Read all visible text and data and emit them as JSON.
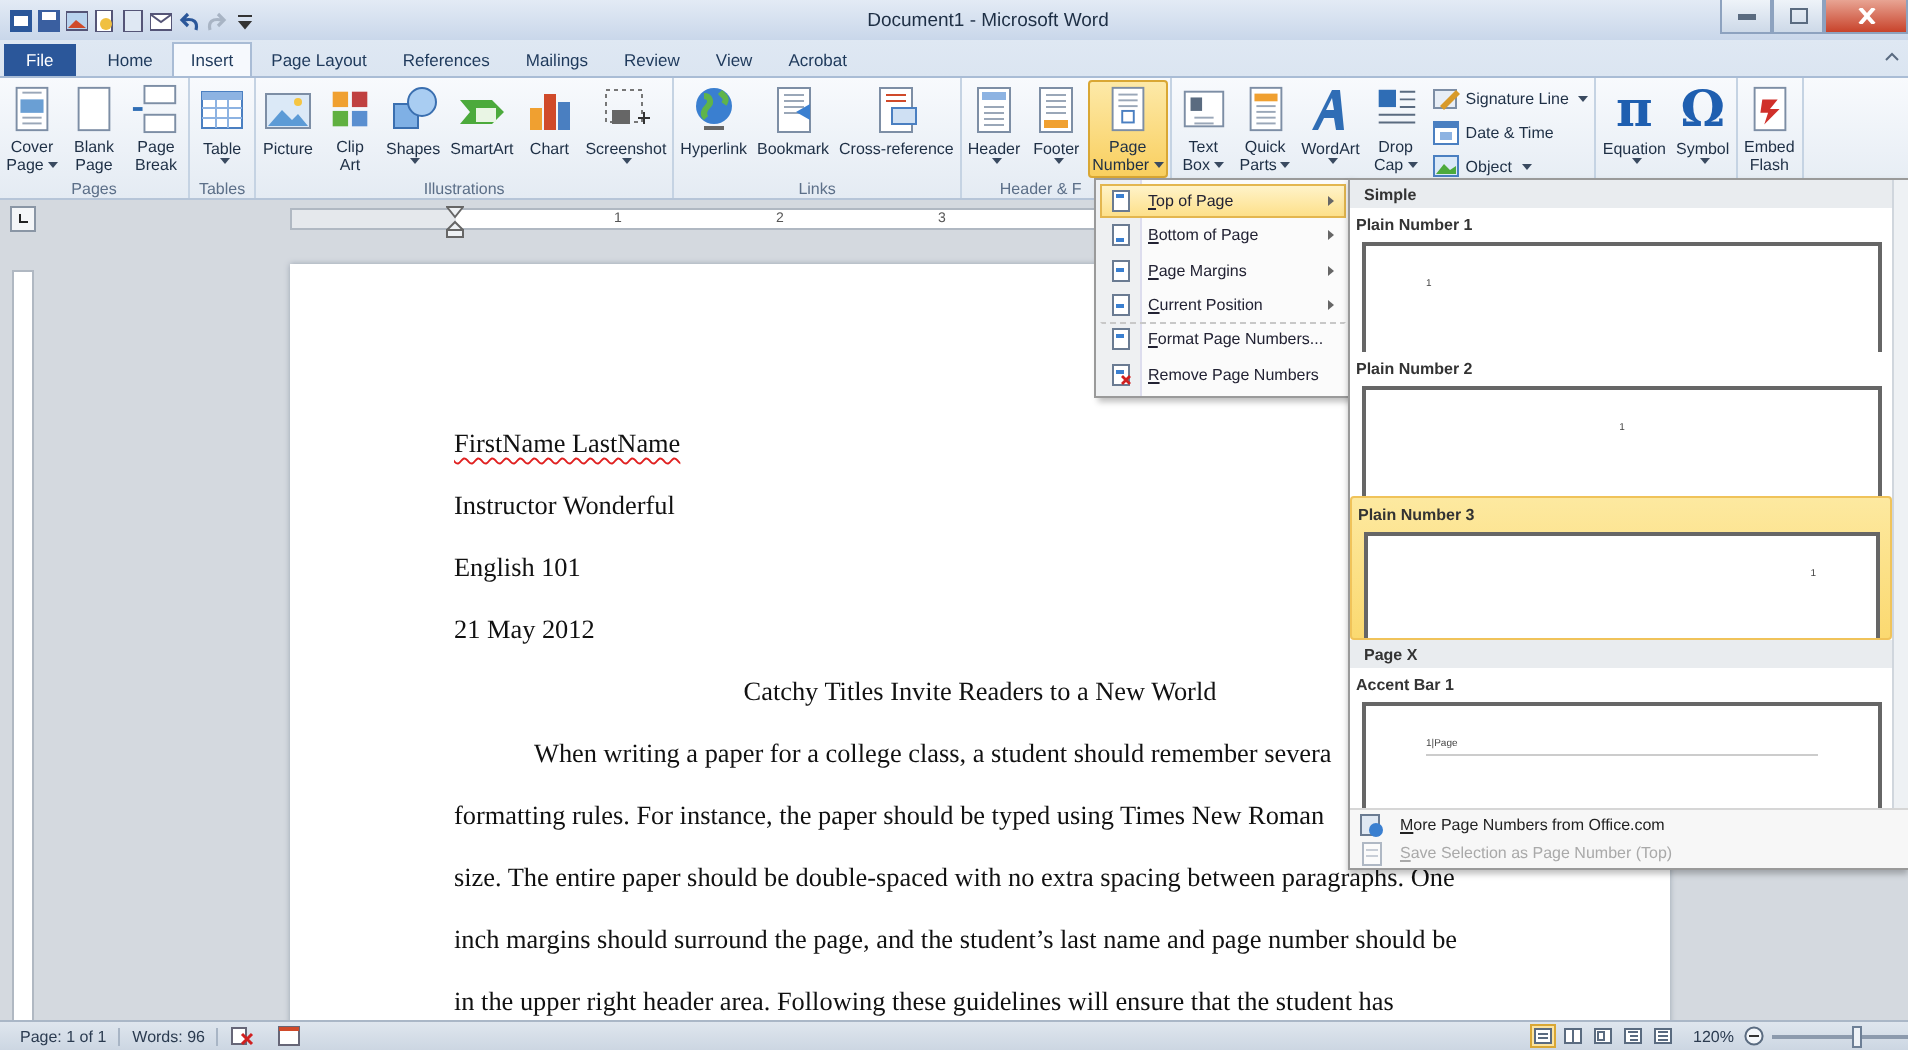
{
  "window": {
    "title": "Document1 - Microsoft Word"
  },
  "tabs": [
    {
      "label": "File",
      "kind": "file",
      "selected": false
    },
    {
      "label": "Home",
      "kind": "tab",
      "selected": false
    },
    {
      "label": "Insert",
      "kind": "tab",
      "selected": true
    },
    {
      "label": "Page Layout",
      "kind": "tab",
      "selected": false
    },
    {
      "label": "References",
      "kind": "tab",
      "selected": false
    },
    {
      "label": "Mailings",
      "kind": "tab",
      "selected": false
    },
    {
      "label": "Review",
      "kind": "tab",
      "selected": false
    },
    {
      "label": "View",
      "kind": "tab",
      "selected": false
    },
    {
      "label": "Acrobat",
      "kind": "tab",
      "selected": false
    }
  ],
  "ribbon": {
    "groups": [
      {
        "label": "Pages",
        "buttons": [
          {
            "label": "Cover\nPage",
            "dropdown": true,
            "active": false
          },
          {
            "label": "Blank\nPage",
            "dropdown": false,
            "active": false
          },
          {
            "label": "Page\nBreak",
            "dropdown": false,
            "active": false
          }
        ]
      },
      {
        "label": "Tables",
        "buttons": [
          {
            "label": "Table",
            "dropdown": true,
            "active": false
          }
        ]
      },
      {
        "label": "Illustrations",
        "buttons": [
          {
            "label": "Picture",
            "dropdown": false,
            "active": false
          },
          {
            "label": "Clip\nArt",
            "dropdown": false,
            "active": false
          },
          {
            "label": "Shapes",
            "dropdown": true,
            "active": false
          },
          {
            "label": "SmartArt",
            "dropdown": false,
            "active": false
          },
          {
            "label": "Chart",
            "dropdown": false,
            "active": false
          },
          {
            "label": "Screenshot",
            "dropdown": true,
            "active": false
          }
        ]
      },
      {
        "label": "Links",
        "buttons": [
          {
            "label": "Hyperlink",
            "dropdown": false,
            "active": false
          },
          {
            "label": "Bookmark",
            "dropdown": false,
            "active": false
          },
          {
            "label": "Cross-reference",
            "dropdown": false,
            "active": false
          }
        ]
      },
      {
        "label": "Header & F",
        "buttons": [
          {
            "label": "Header",
            "dropdown": true,
            "active": false
          },
          {
            "label": "Footer",
            "dropdown": true,
            "active": false
          },
          {
            "label": "Page\nNumber",
            "dropdown": true,
            "active": true
          }
        ]
      },
      {
        "buttons": [
          {
            "label": "Text\nBox",
            "dropdown": true,
            "active": false
          },
          {
            "label": "Quick\nParts",
            "dropdown": true,
            "active": false
          },
          {
            "label": "WordArt",
            "dropdown": true,
            "active": false
          },
          {
            "label": "Drop\nCap",
            "dropdown": true,
            "active": false
          }
        ],
        "small_buttons": [
          {
            "label": "Signature Line",
            "dropdown": true
          },
          {
            "label": "Date & Time",
            "dropdown": false
          },
          {
            "label": "Object",
            "dropdown": true
          }
        ]
      },
      {
        "buttons": [
          {
            "label": "Equation",
            "glyph": "π",
            "dropdown": true,
            "active": false
          },
          {
            "label": "Symbol",
            "glyph": "Ω",
            "dropdown": true,
            "active": false
          }
        ]
      },
      {
        "buttons": [
          {
            "label": "Embed\nFlash",
            "dropdown": false,
            "active": false
          }
        ]
      }
    ]
  },
  "ruler": {
    "numbers": [
      "1",
      "2",
      "3"
    ]
  },
  "document": {
    "lines": [
      {
        "text": "FirstName LastName",
        "kind": "plain",
        "spelling_error": true
      },
      {
        "text": "Instructor Wonderful",
        "kind": "plain",
        "spelling_error": false
      },
      {
        "text": "English 101",
        "kind": "plain",
        "spelling_error": false
      },
      {
        "text": "21 May 2012",
        "kind": "plain",
        "spelling_error": false
      },
      {
        "text": "Catchy Titles Invite Readers to a New World",
        "kind": "title",
        "spelling_error": false
      },
      {
        "text": "When writing a paper for a college  class, a student should remember severa",
        "kind": "indent",
        "spelling_error": false
      },
      {
        "text": "formatting rules. For instance, the paper should be typed using Times New Roman",
        "kind": "plain",
        "spelling_error": false
      },
      {
        "text": "size. The entire paper should be double-spaced with no extra spacing between paragraphs. One",
        "kind": "plain",
        "spelling_error": false
      },
      {
        "text": "inch margins should surround the page, and the student’s last name and page number should be",
        "kind": "plain",
        "spelling_error": false
      },
      {
        "text": "in the upper right header area. Following these guidelines will ensure that the student has",
        "kind": "plain",
        "spelling_error": false
      }
    ]
  },
  "menu": {
    "items": [
      {
        "label": "Top of Page",
        "kind": "submenu",
        "selected": true
      },
      {
        "label": "Bottom of Page",
        "kind": "submenu",
        "selected": false
      },
      {
        "label": "Page Margins",
        "kind": "submenu",
        "selected": false
      },
      {
        "label": "Current Position",
        "kind": "submenu",
        "selected": false
      },
      {
        "label": "Format Page Numbers...",
        "kind": "command",
        "selected": false
      },
      {
        "label": "Remove Page Numbers",
        "kind": "command",
        "selected": false
      }
    ]
  },
  "gallery": {
    "sections": [
      {
        "title": "Simple",
        "items": [
          {
            "label": "Plain Number 1",
            "preview": "1",
            "kind": "left",
            "selected": false
          },
          {
            "label": "Plain Number 2",
            "preview": "1",
            "kind": "center",
            "selected": false
          },
          {
            "label": "Plain Number 3",
            "preview": "1",
            "kind": "right",
            "selected": true
          }
        ]
      },
      {
        "title": "Page X",
        "items": [
          {
            "label": "Accent Bar 1",
            "preview": "1|Page",
            "kind": "accent",
            "selected": false
          }
        ]
      }
    ],
    "footer": [
      {
        "label": "More Page Numbers from Office.com",
        "disabled": false
      },
      {
        "label": "Save Selection as Page Number (Top)",
        "disabled": true
      }
    ]
  },
  "status_bar": {
    "page": "Page: 1 of 1",
    "words": "Words: 96",
    "view_buttons": [
      {
        "selected": true
      },
      {
        "selected": false
      },
      {
        "selected": false
      },
      {
        "selected": false
      },
      {
        "selected": false
      }
    ],
    "zoom": {
      "reading": "120%",
      "level": 0.62
    }
  }
}
